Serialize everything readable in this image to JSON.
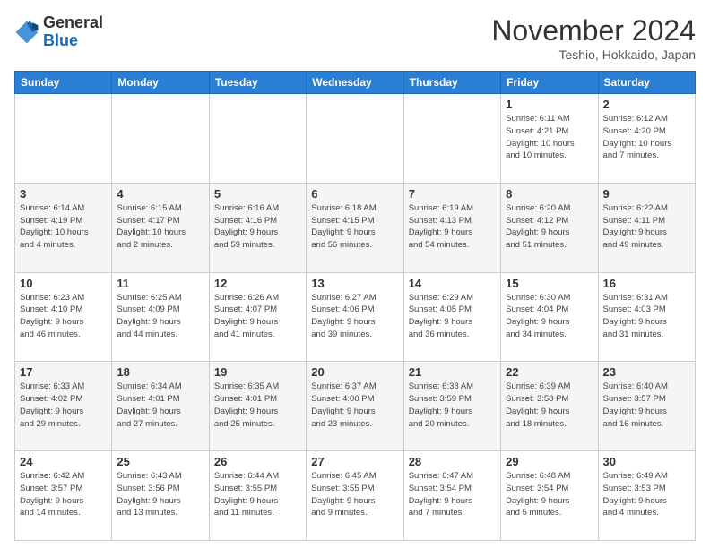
{
  "header": {
    "logo_general": "General",
    "logo_blue": "Blue",
    "month_title": "November 2024",
    "location": "Teshio, Hokkaido, Japan"
  },
  "columns": [
    "Sunday",
    "Monday",
    "Tuesday",
    "Wednesday",
    "Thursday",
    "Friday",
    "Saturday"
  ],
  "weeks": [
    [
      {
        "day": "",
        "info": ""
      },
      {
        "day": "",
        "info": ""
      },
      {
        "day": "",
        "info": ""
      },
      {
        "day": "",
        "info": ""
      },
      {
        "day": "",
        "info": ""
      },
      {
        "day": "1",
        "info": "Sunrise: 6:11 AM\nSunset: 4:21 PM\nDaylight: 10 hours\nand 10 minutes."
      },
      {
        "day": "2",
        "info": "Sunrise: 6:12 AM\nSunset: 4:20 PM\nDaylight: 10 hours\nand 7 minutes."
      }
    ],
    [
      {
        "day": "3",
        "info": "Sunrise: 6:14 AM\nSunset: 4:19 PM\nDaylight: 10 hours\nand 4 minutes."
      },
      {
        "day": "4",
        "info": "Sunrise: 6:15 AM\nSunset: 4:17 PM\nDaylight: 10 hours\nand 2 minutes."
      },
      {
        "day": "5",
        "info": "Sunrise: 6:16 AM\nSunset: 4:16 PM\nDaylight: 9 hours\nand 59 minutes."
      },
      {
        "day": "6",
        "info": "Sunrise: 6:18 AM\nSunset: 4:15 PM\nDaylight: 9 hours\nand 56 minutes."
      },
      {
        "day": "7",
        "info": "Sunrise: 6:19 AM\nSunset: 4:13 PM\nDaylight: 9 hours\nand 54 minutes."
      },
      {
        "day": "8",
        "info": "Sunrise: 6:20 AM\nSunset: 4:12 PM\nDaylight: 9 hours\nand 51 minutes."
      },
      {
        "day": "9",
        "info": "Sunrise: 6:22 AM\nSunset: 4:11 PM\nDaylight: 9 hours\nand 49 minutes."
      }
    ],
    [
      {
        "day": "10",
        "info": "Sunrise: 6:23 AM\nSunset: 4:10 PM\nDaylight: 9 hours\nand 46 minutes."
      },
      {
        "day": "11",
        "info": "Sunrise: 6:25 AM\nSunset: 4:09 PM\nDaylight: 9 hours\nand 44 minutes."
      },
      {
        "day": "12",
        "info": "Sunrise: 6:26 AM\nSunset: 4:07 PM\nDaylight: 9 hours\nand 41 minutes."
      },
      {
        "day": "13",
        "info": "Sunrise: 6:27 AM\nSunset: 4:06 PM\nDaylight: 9 hours\nand 39 minutes."
      },
      {
        "day": "14",
        "info": "Sunrise: 6:29 AM\nSunset: 4:05 PM\nDaylight: 9 hours\nand 36 minutes."
      },
      {
        "day": "15",
        "info": "Sunrise: 6:30 AM\nSunset: 4:04 PM\nDaylight: 9 hours\nand 34 minutes."
      },
      {
        "day": "16",
        "info": "Sunrise: 6:31 AM\nSunset: 4:03 PM\nDaylight: 9 hours\nand 31 minutes."
      }
    ],
    [
      {
        "day": "17",
        "info": "Sunrise: 6:33 AM\nSunset: 4:02 PM\nDaylight: 9 hours\nand 29 minutes."
      },
      {
        "day": "18",
        "info": "Sunrise: 6:34 AM\nSunset: 4:01 PM\nDaylight: 9 hours\nand 27 minutes."
      },
      {
        "day": "19",
        "info": "Sunrise: 6:35 AM\nSunset: 4:01 PM\nDaylight: 9 hours\nand 25 minutes."
      },
      {
        "day": "20",
        "info": "Sunrise: 6:37 AM\nSunset: 4:00 PM\nDaylight: 9 hours\nand 23 minutes."
      },
      {
        "day": "21",
        "info": "Sunrise: 6:38 AM\nSunset: 3:59 PM\nDaylight: 9 hours\nand 20 minutes."
      },
      {
        "day": "22",
        "info": "Sunrise: 6:39 AM\nSunset: 3:58 PM\nDaylight: 9 hours\nand 18 minutes."
      },
      {
        "day": "23",
        "info": "Sunrise: 6:40 AM\nSunset: 3:57 PM\nDaylight: 9 hours\nand 16 minutes."
      }
    ],
    [
      {
        "day": "24",
        "info": "Sunrise: 6:42 AM\nSunset: 3:57 PM\nDaylight: 9 hours\nand 14 minutes."
      },
      {
        "day": "25",
        "info": "Sunrise: 6:43 AM\nSunset: 3:56 PM\nDaylight: 9 hours\nand 13 minutes."
      },
      {
        "day": "26",
        "info": "Sunrise: 6:44 AM\nSunset: 3:55 PM\nDaylight: 9 hours\nand 11 minutes."
      },
      {
        "day": "27",
        "info": "Sunrise: 6:45 AM\nSunset: 3:55 PM\nDaylight: 9 hours\nand 9 minutes."
      },
      {
        "day": "28",
        "info": "Sunrise: 6:47 AM\nSunset: 3:54 PM\nDaylight: 9 hours\nand 7 minutes."
      },
      {
        "day": "29",
        "info": "Sunrise: 6:48 AM\nSunset: 3:54 PM\nDaylight: 9 hours\nand 5 minutes."
      },
      {
        "day": "30",
        "info": "Sunrise: 6:49 AM\nSunset: 3:53 PM\nDaylight: 9 hours\nand 4 minutes."
      }
    ]
  ]
}
